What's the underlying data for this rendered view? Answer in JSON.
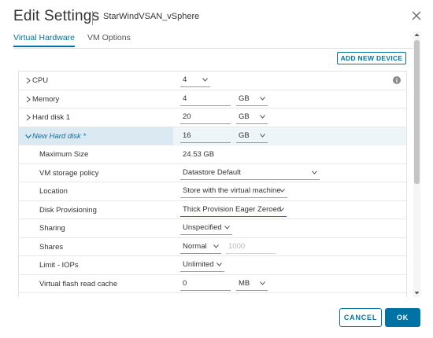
{
  "header": {
    "title": "Edit Settings",
    "subtitle": "StarWindVSAN_vSphere"
  },
  "tabs": [
    {
      "label": "Virtual Hardware",
      "active": true
    },
    {
      "label": "VM Options",
      "active": false
    }
  ],
  "toolbar": {
    "add_device_label": "ADD NEW DEVICE"
  },
  "hardware": {
    "cpu": {
      "label": "CPU",
      "value": "4"
    },
    "memory": {
      "label": "Memory",
      "value": "4",
      "unit": "GB"
    },
    "hard_disk_1": {
      "label": "Hard disk 1",
      "value": "20",
      "unit": "GB"
    },
    "new_hard_disk": {
      "label": "New Hard disk *",
      "value": "16",
      "unit": "GB"
    }
  },
  "disk_settings": {
    "maximum_size": {
      "label": "Maximum Size",
      "value": "24.53 GB"
    },
    "storage_policy": {
      "label": "VM storage policy",
      "value": "Datastore Default"
    },
    "location": {
      "label": "Location",
      "value": "Store with the virtual machine"
    },
    "provisioning": {
      "label": "Disk Provisioning",
      "value": "Thick Provision Eager Zeroed"
    },
    "sharing": {
      "label": "Sharing",
      "value": "Unspecified"
    },
    "shares": {
      "label": "Shares",
      "value": "Normal",
      "amount": "1000"
    },
    "limit_iops": {
      "label": "Limit - IOPs",
      "value": "Unlimited"
    },
    "flash_cache": {
      "label": "Virtual flash read cache",
      "value": "0",
      "unit": "MB"
    }
  },
  "footer": {
    "cancel_label": "CANCEL",
    "ok_label": "OK"
  },
  "colors": {
    "accent": "#0072a3",
    "highlight_row": "#dbe9f2"
  }
}
